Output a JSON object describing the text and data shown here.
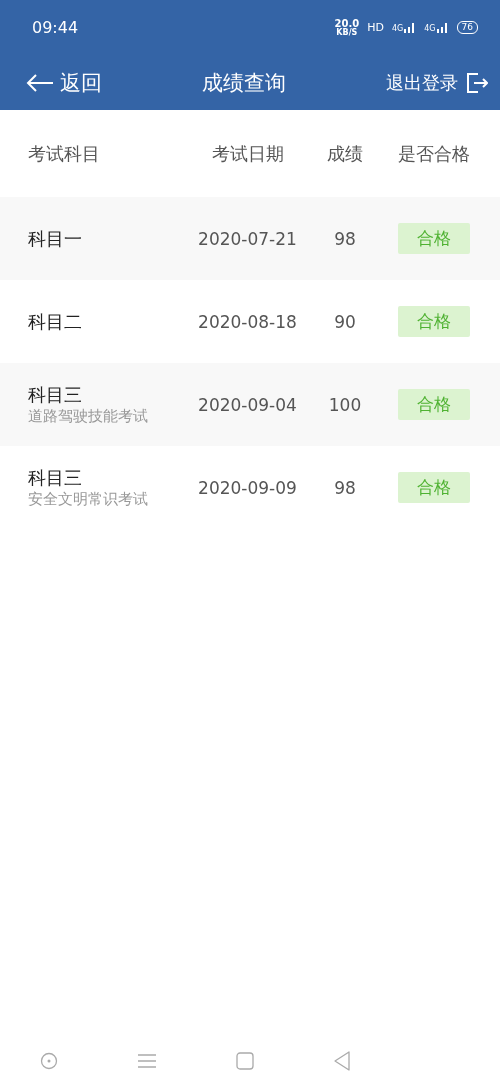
{
  "status_bar": {
    "time": "09:44",
    "speed": "20.0",
    "speed_unit": "KB/S",
    "hd": "HD",
    "networks": [
      "4G",
      "4G"
    ],
    "battery": "76"
  },
  "nav": {
    "back": "返回",
    "title": "成绩查询",
    "logout": "退出登录"
  },
  "table": {
    "columns": [
      "考试科目",
      "考试日期",
      "成绩",
      "是否合格"
    ],
    "rows": [
      {
        "subject": "科目一",
        "date": "2020-07-21",
        "score": "98",
        "result": "合格",
        "passed": true
      },
      {
        "subject": "科目二",
        "date": "2020-08-18",
        "score": "90",
        "result": "合格",
        "passed": true
      },
      {
        "subject": "科目三",
        "detail": "道路驾驶技能考试",
        "date": "2020-09-04",
        "score": "100",
        "result": "合格",
        "passed": true
      },
      {
        "subject": "科目三",
        "detail": "安全文明常识考试",
        "date": "2020-09-09",
        "score": "98",
        "result": "合格",
        "passed": true
      }
    ]
  }
}
